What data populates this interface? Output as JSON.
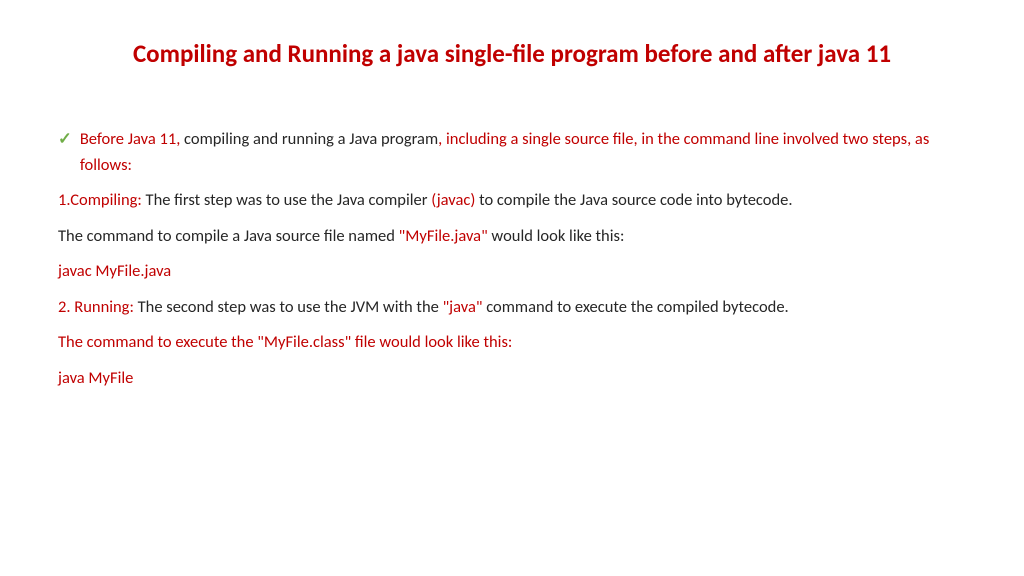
{
  "title": "Compiling and Running a java single-file program before and after java 11",
  "b1": {
    "lead": "Before Java 11,",
    "mid": " compiling and running a Java program",
    "tail": ", including a single source file, in the command line involved two steps, as follows:"
  },
  "p1": {
    "num": "1.",
    "label": "Compiling:",
    "t1": " The first step was to use the Java compiler ",
    "javac": "(javac)",
    "t2": " to compile the Java source code into bytecode."
  },
  "p2": {
    "t1": "The command to compile a Java source file named ",
    "file": "\"MyFile.java\"",
    "t2": " would look like this:"
  },
  "cmd1": "javac MyFile.java",
  "p3": {
    "num": "2. ",
    "label": "Running:",
    "t1": " The second step was to use the  JVM with the ",
    "java": "\"java\"",
    "t2": " command to execute the compiled bytecode."
  },
  "p4": "The command to execute the \"MyFile.class\" file would look like this:",
  "cmd2": "java MyFile"
}
